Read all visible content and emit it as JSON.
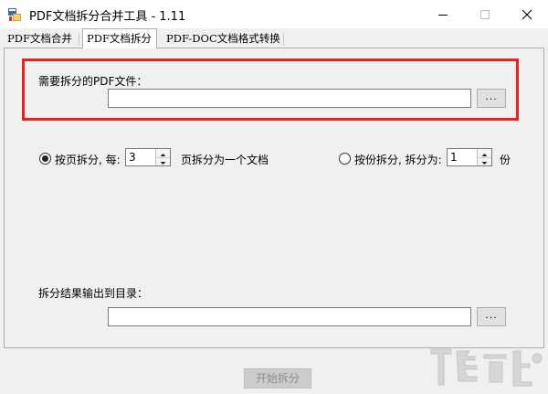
{
  "window": {
    "title": "PDF文档拆分合并工具 - 1.11",
    "icon": "app-pdf-icon",
    "controls": [
      "minimize-icon",
      "maximize-icon",
      "close-icon"
    ]
  },
  "tabs": [
    {
      "label": "PDF文档合并",
      "active": false
    },
    {
      "label": "PDF文档拆分",
      "active": true
    },
    {
      "label": "PDF-DOC文档格式转换",
      "active": false
    }
  ],
  "split": {
    "file_label": "需要拆分的PDF文件：",
    "file_value": "",
    "browse_label": "...",
    "mode_page": {
      "label": "按页拆分, 每:",
      "value": "3",
      "suffix": "页拆分为一个文档",
      "checked": true
    },
    "mode_count": {
      "label": "按份拆分, 拆分为:",
      "value": "1",
      "suffix": "份",
      "checked": false
    },
    "output_label": "拆分结果输出到目录：",
    "output_value": "",
    "output_browse_label": "...",
    "start_label": "开始拆分",
    "start_enabled": false
  },
  "colors": {
    "highlight": "#e8231e",
    "window_bg": "#f0f0f0",
    "titlebar_bg": "#ffffff"
  }
}
